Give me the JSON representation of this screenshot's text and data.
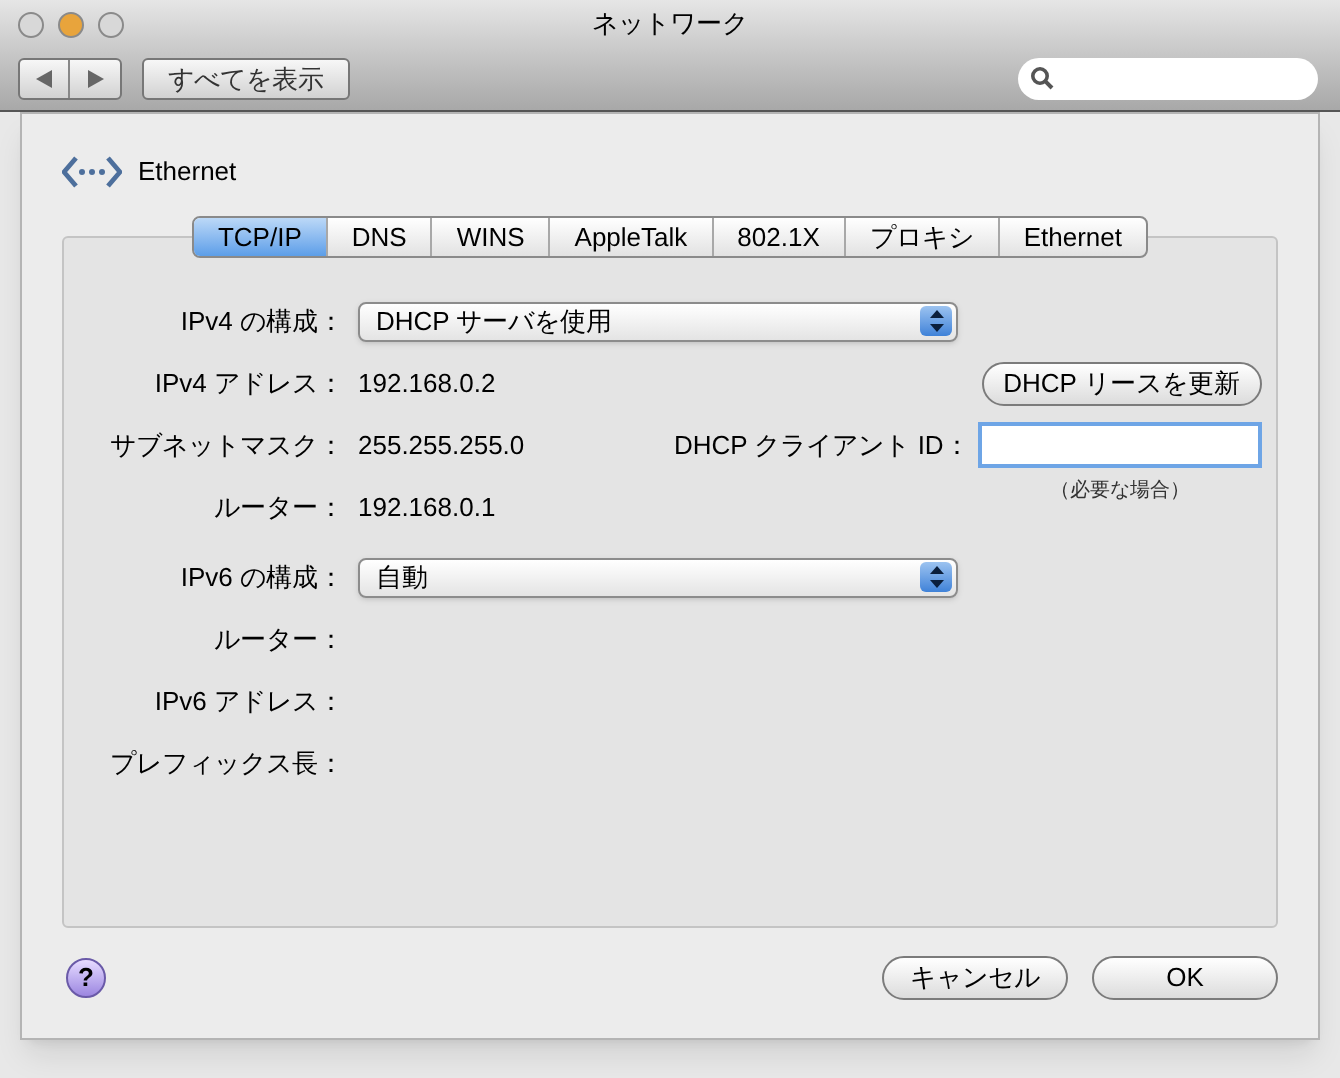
{
  "window": {
    "title": "ネットワーク"
  },
  "toolbar": {
    "show_all": "すべてを表示"
  },
  "sheet": {
    "service": "Ethernet",
    "tabs": [
      {
        "label": "TCP/IP",
        "selected": true
      },
      {
        "label": "DNS",
        "selected": false
      },
      {
        "label": "WINS",
        "selected": false
      },
      {
        "label": "AppleTalk",
        "selected": false
      },
      {
        "label": "802.1X",
        "selected": false
      },
      {
        "label": "プロキシ",
        "selected": false
      },
      {
        "label": "Ethernet",
        "selected": false
      }
    ],
    "rows": [
      {
        "kind": "popup",
        "label": "IPv4 の構成：",
        "value": "DHCP サーバを使用"
      },
      {
        "kind": "text",
        "label": "IPv4 アドレス：",
        "value": "192.168.0.2"
      },
      {
        "kind": "text",
        "label": "サブネットマスク：",
        "value": "255.255.255.0"
      },
      {
        "kind": "text",
        "label": "ルーター：",
        "value": "192.168.0.1"
      },
      {
        "kind": "popup",
        "label": "IPv6 の構成：",
        "value": "自動"
      },
      {
        "kind": "text",
        "label": "ルーター："
      },
      {
        "kind": "text",
        "label": "IPv6 アドレス："
      },
      {
        "kind": "text",
        "label": "プレフィックス長："
      }
    ],
    "renew_button": "DHCP リースを更新",
    "client_id": {
      "label": "DHCP クライアント ID：",
      "hint": "（必要な場合）"
    },
    "help": "?",
    "buttons": [
      "キャンセル",
      "OK"
    ]
  }
}
